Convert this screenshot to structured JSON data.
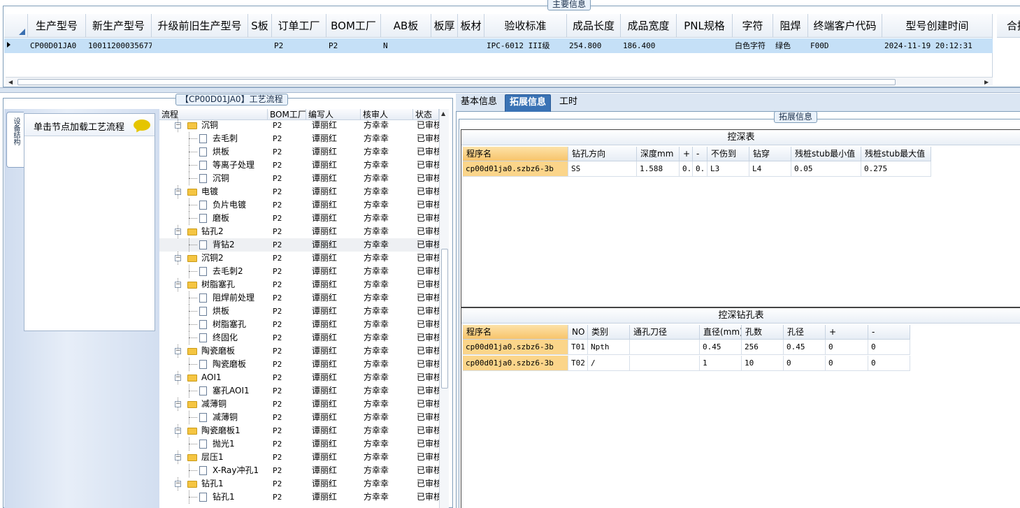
{
  "main_info": {
    "title": "主要信息",
    "columns": [
      "生产型号",
      "新生产型号",
      "升级前旧生产型号",
      "S板",
      "订单工厂",
      "BOM工厂",
      "AB板",
      "板厚",
      "板材",
      "验收标准",
      "成品长度",
      "成品宽度",
      "PNL规格",
      "字符",
      "阻焊",
      "终端客户代码",
      "型号创建时间",
      "合拼"
    ],
    "row": [
      "CP00D01JA0",
      "10011200035677",
      "",
      "",
      "P2",
      "P2",
      "N",
      "",
      "",
      "IPC-6012 III级",
      "254.800",
      "186.400",
      "",
      "白色字符",
      "绿色",
      "F00D",
      "2024-11-19 20:12:31",
      ""
    ]
  },
  "process": {
    "title": "【CP00D01JA0】工艺流程",
    "side_tab": "设备结构",
    "load_hint": "单击节点加载工艺流程",
    "columns": [
      "流程",
      "BOM工厂",
      "编写人",
      "核审人",
      "状态"
    ],
    "rows": [
      {
        "name": "沉铜",
        "level": 0,
        "bom": "P2",
        "writer": "谭丽红",
        "reviewer": "方幸幸",
        "status": "已审核"
      },
      {
        "name": "去毛刺",
        "level": 1,
        "bom": "P2",
        "writer": "谭丽红",
        "reviewer": "方幸幸",
        "status": "已审核"
      },
      {
        "name": "烘板",
        "level": 1,
        "bom": "P2",
        "writer": "谭丽红",
        "reviewer": "方幸幸",
        "status": "已审核"
      },
      {
        "name": "等离子处理",
        "level": 1,
        "bom": "P2",
        "writer": "谭丽红",
        "reviewer": "方幸幸",
        "status": "已审核"
      },
      {
        "name": "沉铜",
        "level": 1,
        "bom": "P2",
        "writer": "谭丽红",
        "reviewer": "方幸幸",
        "status": "已审核"
      },
      {
        "name": "电镀",
        "level": 0,
        "bom": "P2",
        "writer": "谭丽红",
        "reviewer": "方幸幸",
        "status": "已审核"
      },
      {
        "name": "负片电镀",
        "level": 1,
        "bom": "P2",
        "writer": "谭丽红",
        "reviewer": "方幸幸",
        "status": "已审核"
      },
      {
        "name": "磨板",
        "level": 1,
        "bom": "P2",
        "writer": "谭丽红",
        "reviewer": "方幸幸",
        "status": "已审核"
      },
      {
        "name": "钻孔2",
        "level": 0,
        "bom": "P2",
        "writer": "谭丽红",
        "reviewer": "方幸幸",
        "status": "已审核"
      },
      {
        "name": "背钻2",
        "level": 1,
        "bom": "P2",
        "writer": "谭丽红",
        "reviewer": "方幸幸",
        "status": "已审核",
        "selected": true
      },
      {
        "name": "沉铜2",
        "level": 0,
        "bom": "P2",
        "writer": "谭丽红",
        "reviewer": "方幸幸",
        "status": "已审核"
      },
      {
        "name": "去毛刺2",
        "level": 1,
        "bom": "P2",
        "writer": "谭丽红",
        "reviewer": "方幸幸",
        "status": "已审核"
      },
      {
        "name": "树脂塞孔",
        "level": 0,
        "bom": "P2",
        "writer": "谭丽红",
        "reviewer": "方幸幸",
        "status": "已审核"
      },
      {
        "name": "阻焊前处理",
        "level": 1,
        "bom": "P2",
        "writer": "谭丽红",
        "reviewer": "方幸幸",
        "status": "已审核"
      },
      {
        "name": "烘板",
        "level": 1,
        "bom": "P2",
        "writer": "谭丽红",
        "reviewer": "方幸幸",
        "status": "已审核"
      },
      {
        "name": "树脂塞孔",
        "level": 1,
        "bom": "P2",
        "writer": "谭丽红",
        "reviewer": "方幸幸",
        "status": "已审核"
      },
      {
        "name": "终固化",
        "level": 1,
        "bom": "P2",
        "writer": "谭丽红",
        "reviewer": "方幸幸",
        "status": "已审核"
      },
      {
        "name": "陶瓷磨板",
        "level": 0,
        "bom": "P2",
        "writer": "谭丽红",
        "reviewer": "方幸幸",
        "status": "已审核"
      },
      {
        "name": "陶瓷磨板",
        "level": 1,
        "bom": "P2",
        "writer": "谭丽红",
        "reviewer": "方幸幸",
        "status": "已审核"
      },
      {
        "name": "AOI1",
        "level": 0,
        "bom": "P2",
        "writer": "谭丽红",
        "reviewer": "方幸幸",
        "status": "已审核"
      },
      {
        "name": "塞孔AOI1",
        "level": 1,
        "bom": "P2",
        "writer": "谭丽红",
        "reviewer": "方幸幸",
        "status": "已审核"
      },
      {
        "name": "减薄铜",
        "level": 0,
        "bom": "P2",
        "writer": "谭丽红",
        "reviewer": "方幸幸",
        "status": "已审核"
      },
      {
        "name": "减薄铜",
        "level": 1,
        "bom": "P2",
        "writer": "谭丽红",
        "reviewer": "方幸幸",
        "status": "已审核"
      },
      {
        "name": "陶瓷磨板1",
        "level": 0,
        "bom": "P2",
        "writer": "谭丽红",
        "reviewer": "方幸幸",
        "status": "已审核"
      },
      {
        "name": "抛光1",
        "level": 1,
        "bom": "P2",
        "writer": "谭丽红",
        "reviewer": "方幸幸",
        "status": "已审核"
      },
      {
        "name": "层压1",
        "level": 0,
        "bom": "P2",
        "writer": "谭丽红",
        "reviewer": "方幸幸",
        "status": "已审核"
      },
      {
        "name": "X-Ray冲孔1",
        "level": 1,
        "bom": "P2",
        "writer": "谭丽红",
        "reviewer": "方幸幸",
        "status": "已审核"
      },
      {
        "name": "钻孔1",
        "level": 0,
        "bom": "P2",
        "writer": "谭丽红",
        "reviewer": "方幸幸",
        "status": "已审核"
      },
      {
        "name": "钻孔1",
        "level": 1,
        "bom": "P2",
        "writer": "谭丽红",
        "reviewer": "方幸幸",
        "status": "已审核"
      }
    ]
  },
  "tabs": [
    "基本信息",
    "拓展信息",
    "工时"
  ],
  "ext_title": "拓展信息",
  "depth_table": {
    "title": "控深表",
    "columns": [
      "程序名",
      "钻孔方向",
      "深度mm",
      "+",
      "-",
      "不伤到",
      "钻穿",
      "残桩stub最小值",
      "残桩stub最大值"
    ],
    "rows": [
      [
        "cp00d01ja0.szbz6-3b",
        "SS",
        "1.588",
        "0.",
        "0.",
        "L3",
        "L4",
        "0.05",
        "0.275"
      ]
    ]
  },
  "hole_table": {
    "title": "控深钻孔表",
    "columns": [
      "程序名",
      "NO",
      "类别",
      "通孔刀径",
      "直径(mm)",
      "孔数",
      "孔径",
      "+",
      "-"
    ],
    "rows": [
      [
        "cp00d01ja0.szbz6-3b",
        "T01",
        "Npth",
        "",
        "0.45",
        "256",
        "0.45",
        "0",
        "0"
      ],
      [
        "cp00d01ja0.szbz6-3b",
        "T02",
        "/",
        "",
        "1",
        "10",
        "0",
        "0",
        "0"
      ]
    ]
  }
}
